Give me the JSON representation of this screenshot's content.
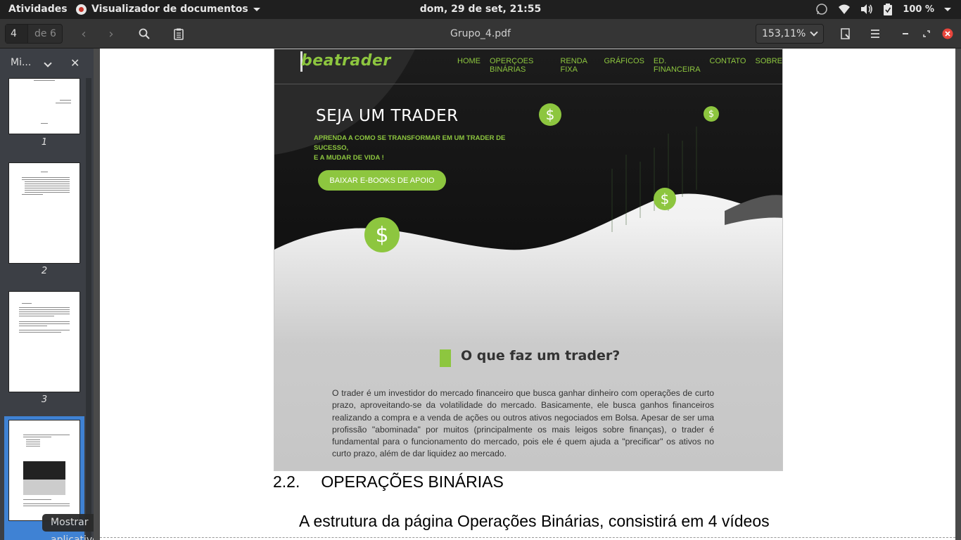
{
  "topbar": {
    "activities": "Atividades",
    "app_name": "Visualizador de documentos",
    "clock": "dom, 29 de set, 21:55",
    "battery": "100 %"
  },
  "toolbar": {
    "page_current": "4",
    "page_of": "de 6",
    "document_title": "Grupo_4.pdf",
    "zoom": "153,11%"
  },
  "sidebar": {
    "title": "Mi...",
    "thumbnails": [
      "1",
      "2",
      "3",
      "4"
    ],
    "tooltip": "Mostrar aplicativos"
  },
  "website": {
    "logo": "beatrader",
    "nav": [
      "HOME",
      "OPERÇOES BINÁRIAS",
      "RENDA FIXA",
      "GRÁFICOS",
      "ED. FINANCEIRA",
      "CONTATO",
      "SOBRE"
    ],
    "hero_title": "SEJA UM TRADER",
    "hero_sub_1": "APRENDA A COMO SE TRANSFORMAR EM UM TRADER DE SUCESSO,",
    "hero_sub_2": "E A MUDAR DE VIDA !",
    "cta": "BAIXAR E-BOOKS DE APOIO",
    "coin_symbol": "$",
    "section_title": "O que faz um trader?",
    "section_text": "O trader é um investidor do mercado financeiro que busca ganhar dinheiro com operações de curto prazo, aproveitando-se da volatilidade do mercado. Basicamente, ele busca ganhos financeiros realizando a compra e a venda de ações ou outros ativos negociados em Bolsa. Apesar de ser uma profissão \"abominada\" por muitos (principalmente os mais leigos sobre finanças), o trader é fundamental para o funcionamento do mercado, pois ele é quem ajuda a \"precificar\" os ativos no curto prazo, além de dar liquidez ao mercado.",
    "accent_color": "#8dc63f"
  },
  "document": {
    "heading_number": "2.2.",
    "heading_text": "OPERAÇÕES BINÁRIAS",
    "body_line": "A estrutura da página Operações Binárias, consistirá em 4 vídeos"
  }
}
